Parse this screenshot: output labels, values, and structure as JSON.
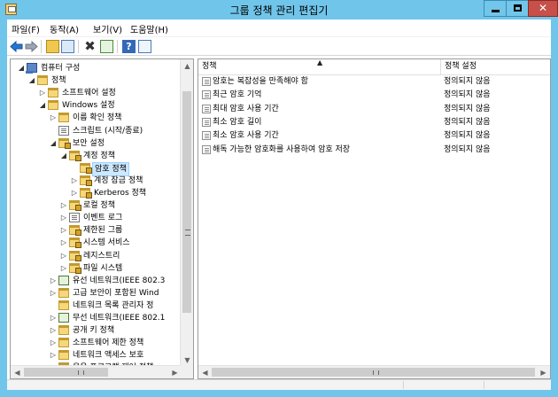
{
  "window": {
    "title": "그룹 정책 관리 편집기",
    "colors": {
      "titlebar": "#70c5ea",
      "close": "#c7504a",
      "selection": "#cde8ff"
    }
  },
  "menu": {
    "items": [
      "파일(F)",
      "동작(A)",
      "보기(V)",
      "도움말(H)"
    ]
  },
  "toolbar": {
    "icons": [
      "back-arrow-icon",
      "forward-arrow-icon",
      "up-folder-icon",
      "show-hide-tree-icon",
      "delete-icon",
      "export-icon",
      "help-icon",
      "properties-icon"
    ],
    "help_glyph": "?",
    "delete_glyph": "✖"
  },
  "tree": {
    "items": [
      {
        "label": "컴퓨터 구성",
        "expander": "◢",
        "icon": "computer"
      },
      {
        "label": "정책",
        "expander": "◢",
        "icon": "folder"
      },
      {
        "label": "소프트웨어 설정",
        "expander": "▷",
        "icon": "folder"
      },
      {
        "label": "Windows 설정",
        "expander": "◢",
        "icon": "folder"
      },
      {
        "label": "이름 확인 정책",
        "expander": "▷",
        "icon": "folder"
      },
      {
        "label": "스크립트 (시작/종료)",
        "expander": "",
        "icon": "policy"
      },
      {
        "label": "보안 설정",
        "expander": "◢",
        "icon": "folder-lock"
      },
      {
        "label": "계정 정책",
        "expander": "◢",
        "icon": "folder-lock"
      },
      {
        "label": "암호 정책",
        "expander": "",
        "icon": "folder-lock",
        "selected": true
      },
      {
        "label": "계정 잠금 정책",
        "expander": "▷",
        "icon": "folder-lock"
      },
      {
        "label": "Kerberos 정책",
        "expander": "▷",
        "icon": "folder-lock"
      },
      {
        "label": "로컬 정책",
        "expander": "▷",
        "icon": "folder-lock"
      },
      {
        "label": "이벤트 로그",
        "expander": "▷",
        "icon": "policy"
      },
      {
        "label": "제한된 그룹",
        "expander": "▷",
        "icon": "folder-lock"
      },
      {
        "label": "시스템 서비스",
        "expander": "▷",
        "icon": "folder-lock"
      },
      {
        "label": "레지스트리",
        "expander": "▷",
        "icon": "folder-lock"
      },
      {
        "label": "파일 시스템",
        "expander": "▷",
        "icon": "folder-lock"
      },
      {
        "label": "유선 네트워크(IEEE 802.3",
        "expander": "▷",
        "icon": "network"
      },
      {
        "label": "고급 보안이 포함된 Wind",
        "expander": "▷",
        "icon": "folder"
      },
      {
        "label": "네트워크 목록 관리자 정",
        "expander": "",
        "icon": "folder"
      },
      {
        "label": "무선 네트워크(IEEE 802.1",
        "expander": "▷",
        "icon": "network"
      },
      {
        "label": "공개 키 정책",
        "expander": "▷",
        "icon": "folder"
      },
      {
        "label": "소프트웨어 제한 정책",
        "expander": "▷",
        "icon": "folder"
      },
      {
        "label": "네트워크 액세스 보호",
        "expander": "▷",
        "icon": "folder"
      },
      {
        "label": "응용 프로그램 제어 정책",
        "expander": "▷",
        "icon": "folder"
      }
    ]
  },
  "table": {
    "headers": {
      "policy": "정책",
      "setting": "정책 설정"
    },
    "rows": [
      {
        "policy": "암호는 복잡성을 만족해야 함",
        "setting": "정의되지 않음"
      },
      {
        "policy": "최근 암호 기억",
        "setting": "정의되지 않음"
      },
      {
        "policy": "최대 암호 사용 기간",
        "setting": "정의되지 않음"
      },
      {
        "policy": "최소 암호 길이",
        "setting": "정의되지 않음"
      },
      {
        "policy": "최소 암호 사용 기간",
        "setting": "정의되지 않음"
      },
      {
        "policy": "해독 가능한 암호화를 사용하여 암호 저장",
        "setting": "정의되지 않음"
      }
    ]
  }
}
